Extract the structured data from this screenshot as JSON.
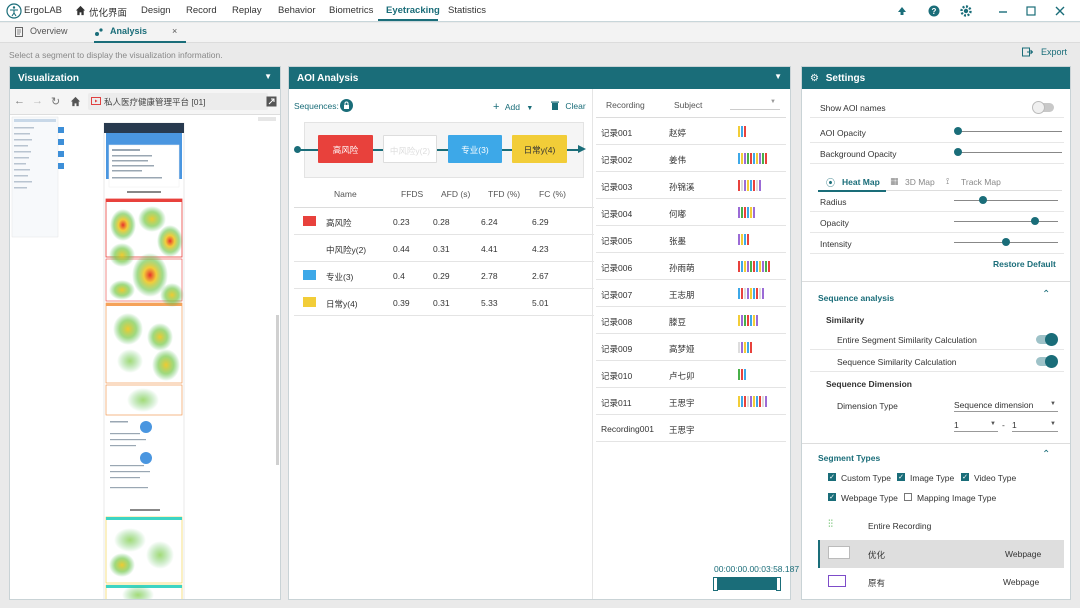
{
  "app": {
    "brand": "ErgoLAB",
    "home_label": "优化界面",
    "menu": [
      "Design",
      "Record",
      "Replay",
      "Behavior",
      "Biometrics",
      "Eyetracking",
      "Statistics"
    ],
    "active_menu": "Eyetracking"
  },
  "tabs": {
    "overview": "Overview",
    "analysis": "Analysis",
    "close": "×"
  },
  "hint": "Select a segment to display the visualization information.",
  "export_label": "Export",
  "visualization": {
    "title": "Visualization",
    "url": "私人医疗健康管理平台 [01]"
  },
  "aoi": {
    "title": "AOI Analysis",
    "sequences_label": "Sequences:",
    "add_label": "Add",
    "clear_label": "Clear",
    "sequence": [
      {
        "label": "高风险",
        "color": "#e8413c",
        "text": "#fff"
      },
      {
        "label": "中风险y(2)",
        "color": "#ffffff",
        "text": "#ccc"
      },
      {
        "label": "专业(3)",
        "color": "#3da8e8",
        "text": "#fff"
      },
      {
        "label": "日常y(4)",
        "color": "#f2cd38",
        "text": "#333"
      }
    ],
    "columns": [
      "Name",
      "FFDS",
      "AFD (s)",
      "TFD (%)",
      "FC (%)"
    ],
    "rows": [
      {
        "name": "高风险",
        "color": "#e8413c",
        "ffds": "0.23",
        "afd": "0.28",
        "tfd": "6.24",
        "fc": "6.29"
      },
      {
        "name": "中风险y(2)",
        "color": "",
        "ffds": "0.44",
        "afd": "0.31",
        "tfd": "4.41",
        "fc": "4.23"
      },
      {
        "name": "专业(3)",
        "color": "#3da8e8",
        "ffds": "0.4",
        "afd": "0.29",
        "tfd": "2.78",
        "fc": "2.67"
      },
      {
        "name": "日常y(4)",
        "color": "#f2cd38",
        "ffds": "0.39",
        "afd": "0.31",
        "tfd": "5.33",
        "fc": "5.01"
      }
    ],
    "rec_columns": [
      "Recording",
      "Subject"
    ],
    "recordings": [
      {
        "rec": "记录001",
        "subj": "赵婷"
      },
      {
        "rec": "记录002",
        "subj": "姜伟"
      },
      {
        "rec": "记录003",
        "subj": "孙锦溪"
      },
      {
        "rec": "记录004",
        "subj": "何嘟"
      },
      {
        "rec": "记录005",
        "subj": "张墨"
      },
      {
        "rec": "记录006",
        "subj": "孙雨萌"
      },
      {
        "rec": "记录007",
        "subj": "王志朋"
      },
      {
        "rec": "记录008",
        "subj": "滕豆"
      },
      {
        "rec": "记录009",
        "subj": "高梦娅"
      },
      {
        "rec": "记录010",
        "subj": "卢七卯"
      },
      {
        "rec": "记录011",
        "subj": "王思宇"
      },
      {
        "rec": "Recording001",
        "subj": "王思宇"
      }
    ],
    "time": "00:00:00.00:03:58.187"
  },
  "settings": {
    "title": "Settings",
    "show_aoi_names": "Show AOI names",
    "aoi_opacity": "AOI Opacity",
    "bg_opacity": "Background Opacity",
    "aoi_opacity_value": 0.0,
    "bg_opacity_value": 0.0,
    "map_tabs": [
      "Heat Map",
      "3D Map",
      "Track Map"
    ],
    "radius": "Radius",
    "opacity": "Opacity",
    "intensity": "Intensity",
    "radius_value": 0.28,
    "opacity_value": 0.78,
    "intensity_value": 0.5,
    "restore": "Restore Default",
    "sequence_analysis": "Sequence analysis",
    "similarity": "Similarity",
    "entire_segment": "Entire Segment Similarity Calculation",
    "sequence_similarity": "Sequence Similarity Calculation",
    "sequence_dimension": "Sequence Dimension",
    "dimension_type": "Dimension Type",
    "dimension_value": "Sequence dimension",
    "range_from": "1",
    "range_to": "1",
    "range_sep": "-",
    "segment_types": "Segment Types",
    "types": [
      {
        "label": "Custom Type",
        "checked": true
      },
      {
        "label": "Image Type",
        "checked": true
      },
      {
        "label": "Video Type",
        "checked": true
      },
      {
        "label": "Webpage Type",
        "checked": true
      },
      {
        "label": "Mapping Image Type",
        "checked": false
      }
    ],
    "segments": [
      {
        "name": "Entire Recording",
        "type": ""
      },
      {
        "name": "优化",
        "type": "Webpage"
      },
      {
        "name": "原有",
        "type": "Webpage"
      }
    ]
  },
  "colors": {
    "accent": "#1a6d79"
  }
}
